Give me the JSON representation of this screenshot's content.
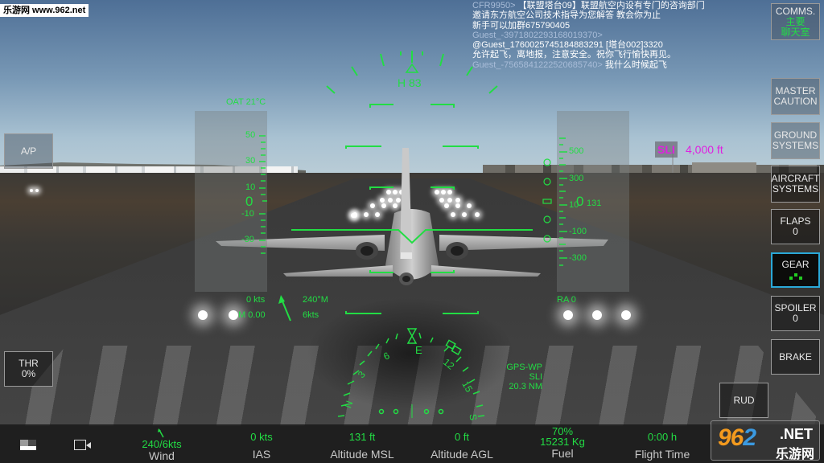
{
  "watermark": {
    "text": "乐游网 www.962.net"
  },
  "chat": [
    {
      "name": "CFR9950>",
      "msg": "【联盟塔台09】联盟航空内设有专门的咨询部门"
    },
    {
      "name": "",
      "msg": "邀请东方航空公司技术指导为您解答 教会你为止"
    },
    {
      "name": "",
      "msg": "新手可以加群675790405"
    },
    {
      "name": "Guest_-3971802293168019370>",
      "msg": ""
    },
    {
      "name": "",
      "msg": "@Guest_1760025745184883291 [塔台002]3320"
    },
    {
      "name": "",
      "msg": "允许起飞，离地报，注意安全。祝你飞行愉快再见。"
    },
    {
      "name": "Guest_-7565841222520685740>",
      "msg": "我什么时候起飞"
    }
  ],
  "right_buttons": [
    {
      "id": "comms",
      "label": "COMMS.",
      "sub": "主要\n聊天室"
    },
    {
      "id": "master-caution",
      "label": "MASTER\nCAUTION",
      "sub": ""
    },
    {
      "id": "ground-systems",
      "label": "GROUND\nSYSTEMS",
      "sub": ""
    },
    {
      "id": "aircraft-systems",
      "label": "AIRCRAFT\nSYSTEMS",
      "sub": ""
    },
    {
      "id": "flaps",
      "label": "FLAPS",
      "sub": "0"
    },
    {
      "id": "gear",
      "label": "GEAR",
      "sub": "",
      "state": "down",
      "selected": true
    },
    {
      "id": "spoiler",
      "label": "SPOILER",
      "sub": "0"
    },
    {
      "id": "brake",
      "label": "BRAKE",
      "sub": ""
    }
  ],
  "left_buttons": {
    "autopilot": "A/P",
    "throttle_label": "THR",
    "throttle_value": "0%"
  },
  "rudder_button": "RUD",
  "hud": {
    "heading": "H 83",
    "oat": "OAT 21°C",
    "speed_tape": {
      "current": "0",
      "ticks": [
        "50",
        "30",
        "10",
        "-10",
        "-30"
      ]
    },
    "altitude_tape": {
      "vs_current": "0",
      "altitude": "131",
      "ticks": [
        "500",
        "300",
        "10",
        "-100",
        "-300"
      ]
    },
    "ground_speed": "0 kts",
    "mach": "M 0.00",
    "wind_dir": "240°M",
    "wind_speed": "6kts",
    "radio_altitude": "RA 0",
    "waypoint": {
      "label": "SLI",
      "altitude": "4,000 ft"
    },
    "gps": {
      "mode": "GPS-WP",
      "waypoint": "SLI",
      "distance": "20.3 NM"
    },
    "compass": {
      "heading_letter": "E",
      "labels": [
        "N",
        "3",
        "6",
        "E",
        "12",
        "15",
        "S"
      ]
    }
  },
  "bottom_bar": {
    "stats": [
      {
        "id": "wind",
        "value": "240/6kts",
        "label": "Wind"
      },
      {
        "id": "ias",
        "value": "0 kts",
        "label": "IAS"
      },
      {
        "id": "alt-msl",
        "value": "131 ft",
        "label": "Altitude MSL"
      },
      {
        "id": "alt-agl",
        "value": "0 ft",
        "label": "Altitude AGL"
      },
      {
        "id": "fuel",
        "value": "70%",
        "value2": "15231 Kg",
        "label": "Fuel"
      },
      {
        "id": "flight-time",
        "value": "0:00 h",
        "label": "Flight Time"
      }
    ]
  },
  "logo": {
    "num_a": "96",
    "num_b": "2",
    "net": ".NET",
    "cn": "乐游网"
  },
  "colors": {
    "hud_green": "#22dd44",
    "waypoint_magenta": "#e020e0",
    "selected_border": "#2aa8d8"
  }
}
